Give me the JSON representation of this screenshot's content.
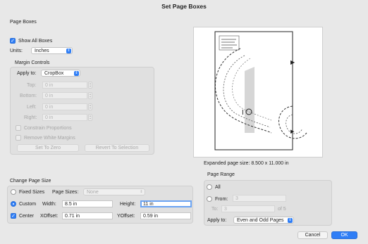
{
  "window": {
    "title": "Set Page Boxes"
  },
  "page_boxes": {
    "section_label": "Page Boxes",
    "show_all_boxes_label": "Show All Boxes",
    "show_all_boxes_checked": true,
    "units_label": "Units:",
    "units_value": "Inches"
  },
  "margin_controls": {
    "label": "Margin Controls",
    "apply_to_label": "Apply to:",
    "apply_to_value": "CropBox",
    "top_label": "Top:",
    "top_value": "0 in",
    "bottom_label": "Bottom:",
    "bottom_value": "0 in",
    "left_label": "Left:",
    "left_value": "0 in",
    "right_label": "Right:",
    "right_value": "0 in",
    "constrain_label": "Constrain Proportions",
    "remove_white_label": "Remove White Margins",
    "set_to_zero_label": "Set To Zero",
    "revert_label": "Revert To Selection"
  },
  "preview": {
    "caption": "Expanded page size: 8.500 x 11.000 in"
  },
  "change_page_size": {
    "label": "Change Page Size",
    "fixed_sizes_label": "Fixed Sizes",
    "page_sizes_label": "Page Sizes:",
    "page_sizes_value": "None",
    "custom_label": "Custom",
    "width_label": "Width:",
    "width_value": "8.5 in",
    "height_label": "Height:",
    "height_value": "11 in",
    "center_label": "Center",
    "xoffset_label": "XOffset:",
    "xoffset_value": "0.71 in",
    "yoffset_label": "YOffset:",
    "yoffset_value": "0.59 in"
  },
  "page_range": {
    "label": "Page Range",
    "all_label": "All",
    "from_label": "From:",
    "from_value": "3",
    "to_label": "To:",
    "to_value": "3",
    "of_label": "of 5",
    "apply_to_label": "Apply to:",
    "apply_to_value": "Even and Odd Pages"
  },
  "footer": {
    "cancel_label": "Cancel",
    "ok_label": "OK"
  },
  "colors": {
    "accent": "#2f7ef6",
    "window_bg": "#e8e8e8"
  }
}
